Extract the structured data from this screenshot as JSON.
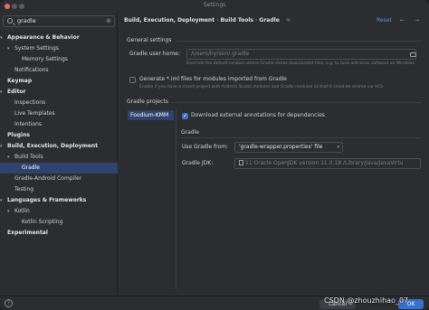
{
  "window": {
    "title": "Settings"
  },
  "sidebar": {
    "search_value": "gradle",
    "items": [
      {
        "label": "Appearance & Behavior",
        "level": 0,
        "bold": true,
        "expanded": true
      },
      {
        "label": "System Settings",
        "level": 1,
        "expanded": true
      },
      {
        "label": "Memory Settings",
        "level": 2
      },
      {
        "label": "Notifications",
        "level": 1
      },
      {
        "label": "Keymap",
        "level": 0,
        "bold": true
      },
      {
        "label": "Editor",
        "level": 0,
        "bold": true,
        "expanded": true
      },
      {
        "label": "Inspections",
        "level": 1
      },
      {
        "label": "Live Templates",
        "level": 1
      },
      {
        "label": "Intentions",
        "level": 1
      },
      {
        "label": "Plugins",
        "level": 0,
        "bold": true
      },
      {
        "label": "Build, Execution, Deployment",
        "level": 0,
        "bold": true,
        "expanded": true
      },
      {
        "label": "Build Tools",
        "level": 1,
        "expanded": true
      },
      {
        "label": "Gradle",
        "level": 2,
        "selected": true
      },
      {
        "label": "Gradle-Android Compiler",
        "level": 1
      },
      {
        "label": "Testing",
        "level": 1
      },
      {
        "label": "Languages & Frameworks",
        "level": 0,
        "bold": true,
        "expanded": true
      },
      {
        "label": "Kotlin",
        "level": 1,
        "expanded": true
      },
      {
        "label": "Kotlin Scripting",
        "level": 2
      },
      {
        "label": "Experimental",
        "level": 0,
        "bold": true
      }
    ]
  },
  "header": {
    "breadcrumb": [
      "Build, Execution, Deployment",
      "Build Tools",
      "Gradle"
    ],
    "reset_label": "Reset",
    "back_glyph": "←",
    "forward_glyph": "→"
  },
  "general": {
    "heading": "General settings",
    "user_home_label": "Gradle user home:",
    "user_home_value": "/Users/hyrson/.gradle",
    "user_home_hint": "Override the default location where Gradle stores downloaded files, e.g. to tune anti-virus software on Windows",
    "iml_label": "Generate *.iml files for modules imported from Gradle",
    "iml_checked": false,
    "iml_hint": "Enable if you have a mixed project with Android Studio modules and Gradle modules so that it could be shared via VCS"
  },
  "projects": {
    "heading": "Gradle projects",
    "items": [
      "Foodium-KMM"
    ],
    "download_annotations_label": "Download external annotations for dependencies",
    "download_annotations_checked": true,
    "gradle_heading": "Gradle",
    "use_gradle_from_label": "Use Gradle from:",
    "use_gradle_from_value": "'gradle-wrapper.properties' file",
    "jdk_label": "Gradle JDK:",
    "jdk_value": "11 Oracle OpenJDK version 11.0.18 /Library/Java/JavaVirtu"
  },
  "footer": {
    "help_glyph": "?",
    "cancel_label": "Cancel",
    "ok_label": "OK",
    "watermark": "CSDN @zhouzhihao_07"
  },
  "colors": {
    "accent": "#3d6ec9",
    "selection": "#2e436e",
    "link": "#5c8fe6",
    "background": "#2b2d31"
  }
}
